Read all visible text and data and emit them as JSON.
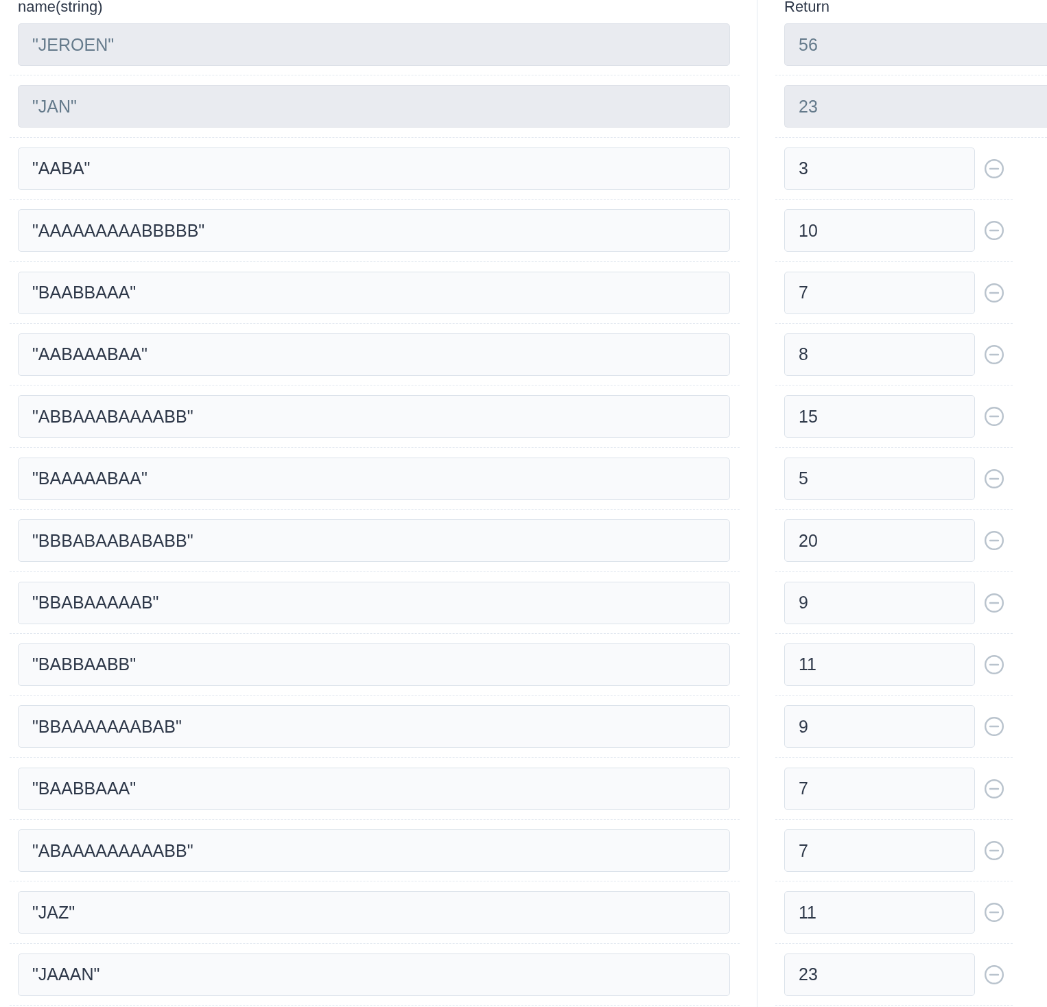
{
  "columns": [
    {
      "label": "name(string)"
    },
    {
      "label": "Return"
    }
  ],
  "rows": [
    {
      "name": "\"JEROEN\"",
      "return": "56",
      "disabled": true
    },
    {
      "name": "\"JAN\"",
      "return": "23",
      "disabled": true
    },
    {
      "name": "\"AABA\"",
      "return": "3",
      "disabled": false
    },
    {
      "name": "\"AAAAAAAAABBBBB\"",
      "return": "10",
      "disabled": false
    },
    {
      "name": "\"BAABBAAA\"",
      "return": "7",
      "disabled": false
    },
    {
      "name": "\"AABAAABAA\"",
      "return": "8",
      "disabled": false
    },
    {
      "name": "\"ABBAAABAAAABB\"",
      "return": "15",
      "disabled": false
    },
    {
      "name": "\"BAAAAABAA\"",
      "return": "5",
      "disabled": false
    },
    {
      "name": "\"BBBABAABABABB\"",
      "return": "20",
      "disabled": false
    },
    {
      "name": "\"BBABAAAAAB\"",
      "return": "9",
      "disabled": false
    },
    {
      "name": "\"BABBAABB\"",
      "return": "11",
      "disabled": false
    },
    {
      "name": "\"BBAAAAAAABAB\"",
      "return": "9",
      "disabled": false
    },
    {
      "name": "\"BAABBAAA\"",
      "return": "7",
      "disabled": false
    },
    {
      "name": "\"ABAAAAAAAAABB\"",
      "return": "7",
      "disabled": false
    },
    {
      "name": "\"JAZ\"",
      "return": "11",
      "disabled": false
    },
    {
      "name": "\"JAAAN\"",
      "return": "23",
      "disabled": false
    }
  ]
}
